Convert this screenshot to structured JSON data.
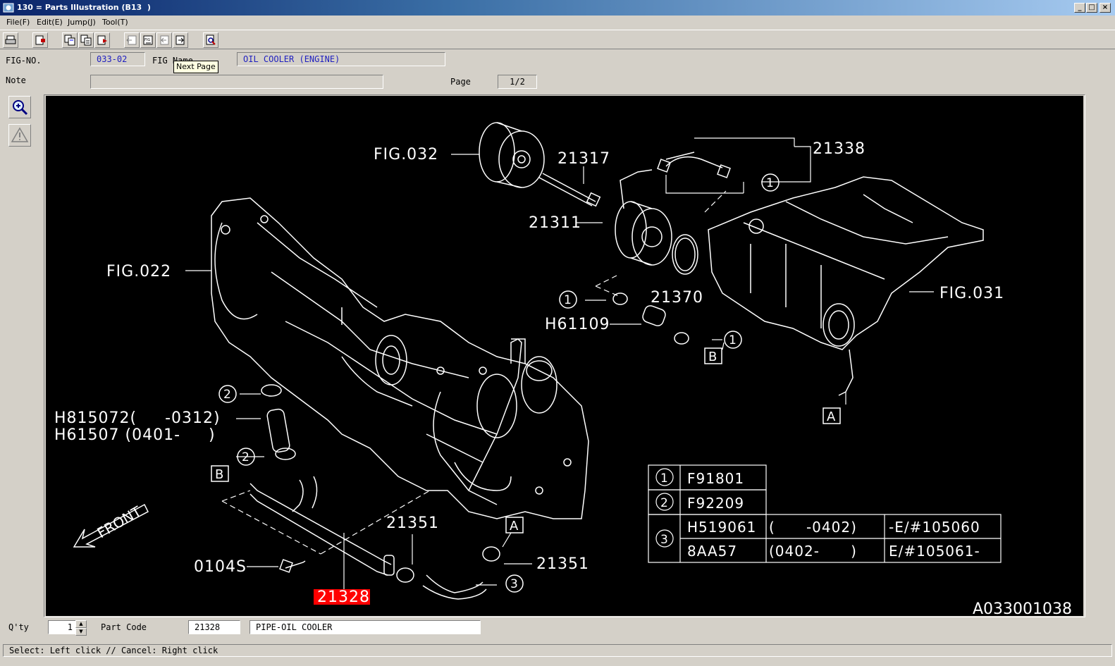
{
  "window": {
    "title": "130 = Parts Illustration (B13  )",
    "controls": [
      "_",
      "□",
      "×"
    ]
  },
  "menu": [
    "File(F)",
    "Edit(E)",
    "Jump(J)",
    "Tool(T)"
  ],
  "toolbar": {
    "icons": [
      "print-icon",
      "exit-icon",
      "copy-icon",
      "copy-list-icon",
      "paste-icon",
      "prev-fig-icon",
      "fig-icon",
      "prev-page-icon",
      "next-page-icon",
      "search-icon"
    ]
  },
  "header": {
    "fig_no_label": "FIG-NO.",
    "fig_no_value": "033-02",
    "fig_name_label": "FIG Name",
    "fig_name_value": "OIL COOLER (ENGINE)",
    "note_label": "Note",
    "note_value": "",
    "page_label": "Page",
    "page_value": "1/2",
    "tooltip": "Next Page"
  },
  "diagram": {
    "callouts": [
      "FIG.032",
      "21317",
      "21338",
      "21311",
      "FIG.022",
      "21370",
      "FIG.031",
      "H61109",
      "H815072(     -0312)",
      "H61507 (0401-     )",
      "21351",
      "21351",
      "0104S",
      "21328",
      "A033001038",
      "FRONT"
    ],
    "markers": [
      "A",
      "A",
      "B",
      "B"
    ],
    "circled_refs": [
      "1",
      "1",
      "1",
      "1",
      "2",
      "2",
      "3"
    ],
    "legend": {
      "rows": [
        {
          "ref": "1",
          "code": "F91801"
        },
        {
          "ref": "2",
          "code": "F92209"
        },
        {
          "ref": "3",
          "entries": [
            {
              "code": "H519061",
              "range": "(      -0402)",
              "serial": "-E/#105060"
            },
            {
              "code": "8AA57",
              "range": "(0402-      )",
              "serial": "E/#105061-"
            }
          ]
        }
      ]
    },
    "selected_part": "21328",
    "colors": {
      "background": "#000000",
      "lines": "#ffffff",
      "highlight": "#ff0000"
    }
  },
  "footer": {
    "qty_label": "Q'ty",
    "qty_value": "1",
    "part_code_label": "Part Code",
    "part_code_value": "21328",
    "part_name_value": "PIPE-OIL COOLER"
  },
  "status": "Select: Left click // Cancel: Right click"
}
